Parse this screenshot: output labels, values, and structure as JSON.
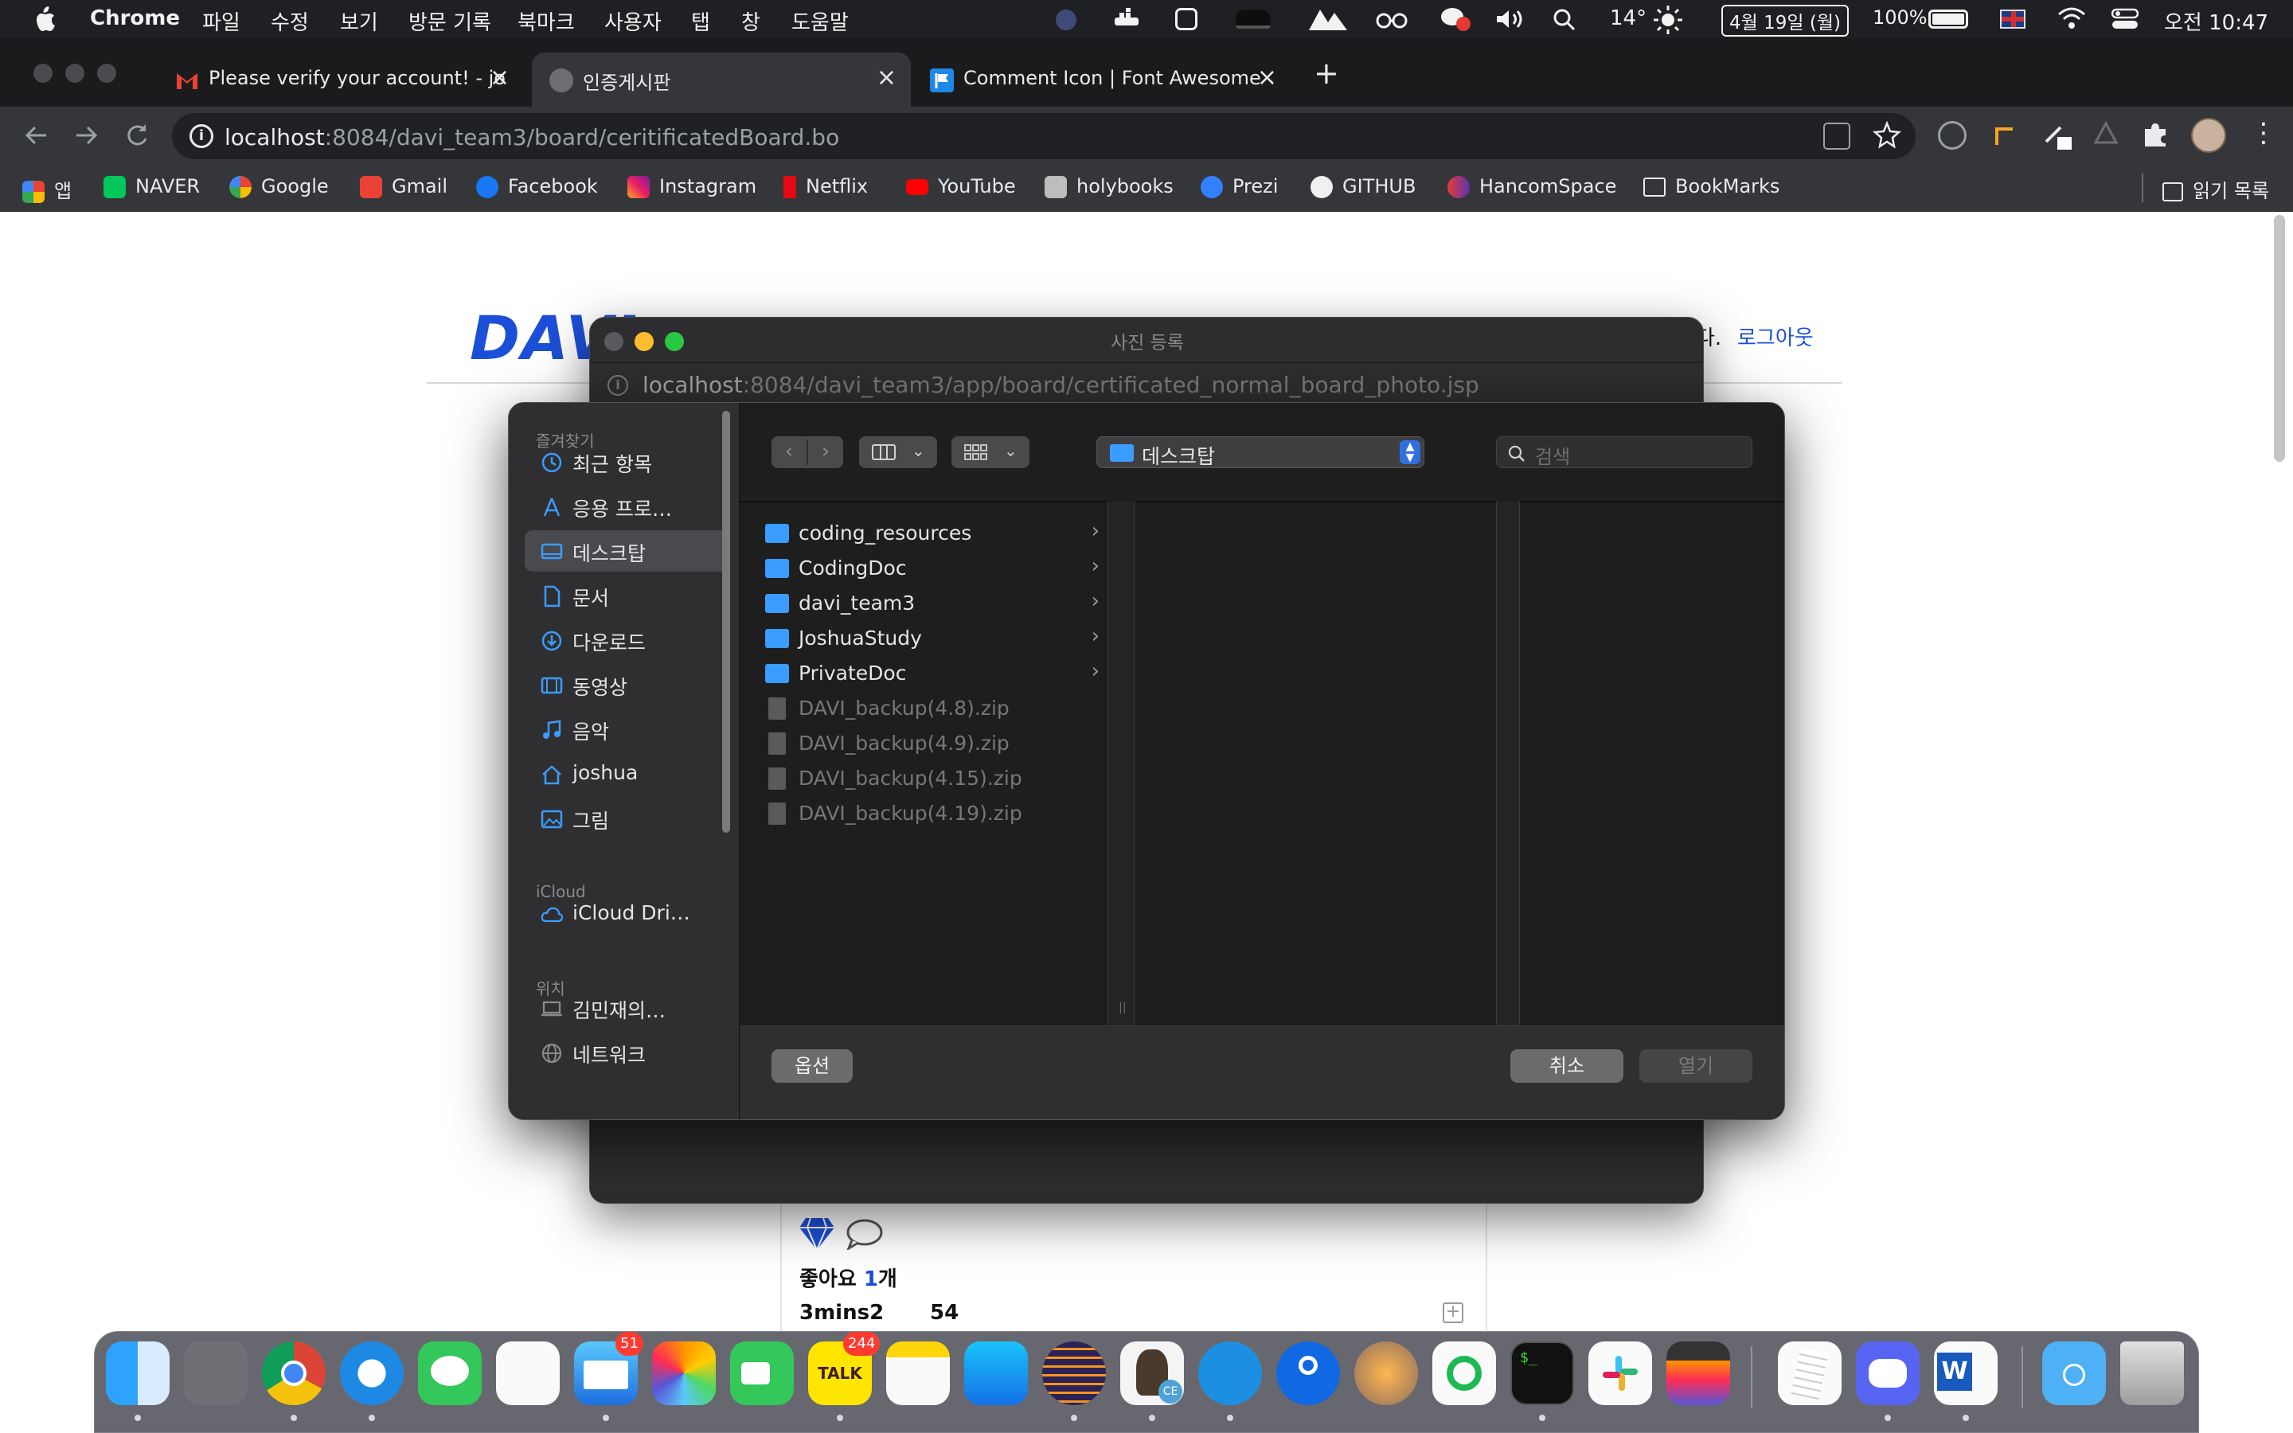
{
  "menubar": {
    "app_name": "Chrome",
    "menus": [
      "파일",
      "수정",
      "보기",
      "방문 기록",
      "북마크",
      "사용자",
      "탭",
      "창",
      "도움말"
    ],
    "temperature": "14°",
    "date": "4월 19일 (월)",
    "battery": "100%",
    "clock": "오전 10:47"
  },
  "browser": {
    "tabs": [
      {
        "title": "Please verify your account! - jo",
        "active": false
      },
      {
        "title": "인증게시판",
        "active": true
      },
      {
        "title": "Comment Icon | Font Awesome",
        "active": false
      }
    ],
    "new_tab": "+",
    "url_host": "localhost",
    "url_rest": ":8084/davi_team3/board/ceritificatedBoard.bo",
    "bookmarks": [
      "앱",
      "NAVER",
      "Google",
      "Gmail",
      "Facebook",
      "Instagram",
      "Netflix",
      "YouTube",
      "holybooks",
      "Prezi",
      "GITHUB",
      "HancomSpace",
      "BookMarks"
    ],
    "reading_list": "읽기 목록"
  },
  "page": {
    "logo": "DAVI",
    "greeting_tail": "다.",
    "logout": "로그아웃",
    "likes_prefix": "좋아요 ",
    "likes_count": "1",
    "likes_suffix": "개",
    "author": "3mins2",
    "count": "54"
  },
  "popup": {
    "title": "사진 등록",
    "url_host": "localhost",
    "url_rest": ":8084/davi_team3/app/board/certificated_normal_board_photo.jsp"
  },
  "dialog": {
    "location": "데스크탑",
    "search_placeholder": "검색",
    "sidebar": {
      "favorites_label": "즐겨찾기",
      "favorites": [
        {
          "label": "최근 항목",
          "icon": "clock-icon"
        },
        {
          "label": "응용 프로…",
          "icon": "applications-icon"
        },
        {
          "label": "데스크탑",
          "icon": "desktop-icon"
        },
        {
          "label": "문서",
          "icon": "document-icon"
        },
        {
          "label": "다운로드",
          "icon": "download-icon"
        },
        {
          "label": "동영상",
          "icon": "film-icon"
        },
        {
          "label": "음악",
          "icon": "music-icon"
        },
        {
          "label": "joshua",
          "icon": "home-icon"
        },
        {
          "label": "그림",
          "icon": "picture-icon"
        }
      ],
      "icloud_label": "iCloud",
      "icloud": [
        {
          "label": "iCloud Dri…",
          "icon": "cloud-icon"
        }
      ],
      "locations_label": "위치",
      "locations": [
        {
          "label": "김민재의…",
          "icon": "laptop-icon"
        },
        {
          "label": "네트워크",
          "icon": "network-icon"
        }
      ]
    },
    "files": [
      {
        "name": "coding_resources",
        "type": "folder"
      },
      {
        "name": "CodingDoc",
        "type": "folder"
      },
      {
        "name": "davi_team3",
        "type": "folder"
      },
      {
        "name": "JoshuaStudy",
        "type": "folder"
      },
      {
        "name": "PrivateDoc",
        "type": "folder"
      },
      {
        "name": "DAVI_backup(4.8).zip",
        "type": "zip"
      },
      {
        "name": "DAVI_backup(4.9).zip",
        "type": "zip"
      },
      {
        "name": "DAVI_backup(4.15).zip",
        "type": "zip"
      },
      {
        "name": "DAVI_backup(4.19).zip",
        "type": "zip"
      }
    ],
    "options_button": "옵션",
    "cancel_button": "취소",
    "open_button": "열기"
  },
  "dock": {
    "badges": {
      "mail": "51",
      "kakaotalk": "244"
    },
    "kakaotalk_label": "TALK"
  }
}
